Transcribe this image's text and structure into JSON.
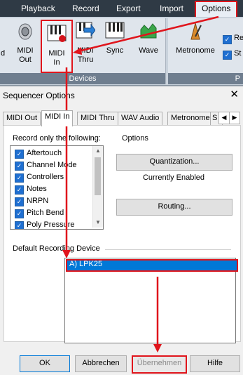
{
  "ribbon": {
    "menu": [
      "Playback",
      "Record",
      "Export",
      "Import",
      "Options"
    ],
    "buttons": {
      "left_partial": "d",
      "midi_out": "MIDI\nOut",
      "midi_in": "MIDI\nIn",
      "midi_thru": "MIDI\nThru",
      "sync": "Sync",
      "wave": "Wave",
      "metronome": "Metronome"
    },
    "group_label": "Devices",
    "right_partial": [
      "Re",
      "St"
    ],
    "right_group_partial": "P"
  },
  "dialog": {
    "title": "Sequencer Options",
    "close": "✕",
    "tabs": [
      "MIDI Out",
      "MIDI In",
      "MIDI Thru",
      "WAV Audio",
      "Metronome",
      "S"
    ],
    "active_tab": "MIDI In",
    "record_label": "Record only the following:",
    "record_items": [
      {
        "label": "Aftertouch",
        "checked": true
      },
      {
        "label": "Channel Mode",
        "checked": true
      },
      {
        "label": "Controllers",
        "checked": true
      },
      {
        "label": "Notes",
        "checked": true
      },
      {
        "label": "NRPN",
        "checked": true
      },
      {
        "label": "Pitch Bend",
        "checked": true
      },
      {
        "label": "Poly Pressure",
        "checked": true
      }
    ],
    "options_label": "Options",
    "quantization_button": "Quantization...",
    "quantization_status": "Currently Enabled",
    "routing_button": "Routing...",
    "device_section_label": "Default Recording Device",
    "devices": [
      "A)  LPK25"
    ],
    "ok": "OK",
    "cancel": "Abbrechen",
    "apply": "Übernehmen",
    "help": "Hilfe"
  },
  "colors": {
    "annotation": "#e0151c",
    "selection": "#0078d7",
    "ribbon_top": "#2f3a45"
  }
}
